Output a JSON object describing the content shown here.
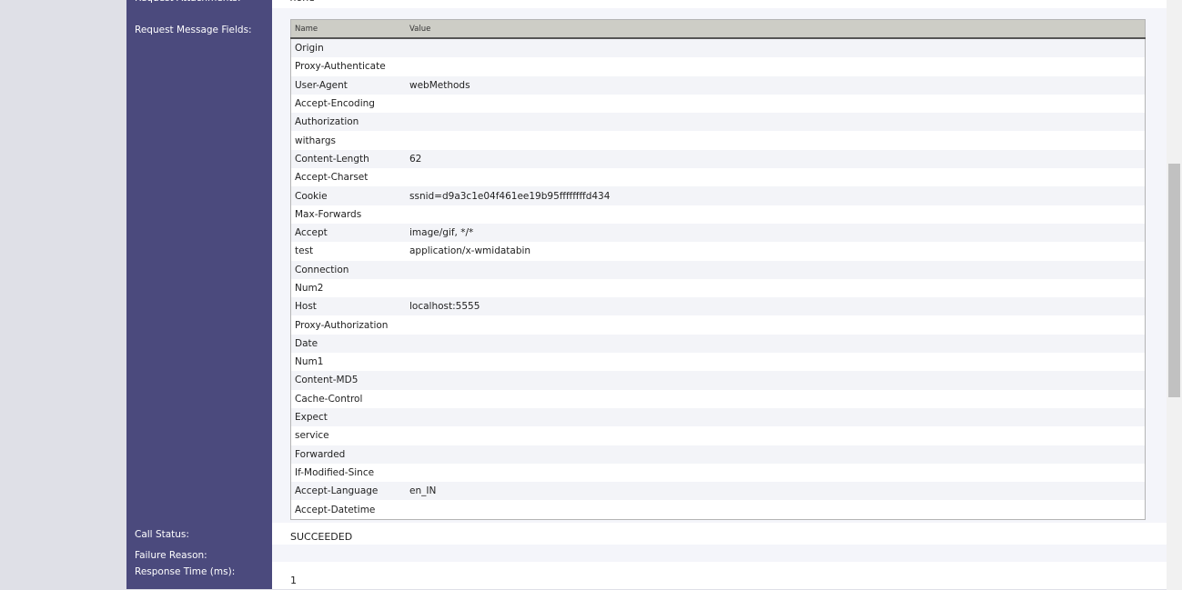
{
  "request_attachments": {
    "label": "Request Attachments:",
    "value": "none"
  },
  "request_message_fields": {
    "label": "Request Message Fields:",
    "columns": [
      "Name",
      "Value"
    ],
    "rows": [
      {
        "name": "Origin",
        "value": ""
      },
      {
        "name": "Proxy-Authenticate",
        "value": ""
      },
      {
        "name": "User-Agent",
        "value": "webMethods"
      },
      {
        "name": "Accept-Encoding",
        "value": ""
      },
      {
        "name": "Authorization",
        "value": ""
      },
      {
        "name": "withargs",
        "value": ""
      },
      {
        "name": "Content-Length",
        "value": "62"
      },
      {
        "name": "Accept-Charset",
        "value": ""
      },
      {
        "name": "Cookie",
        "value": "ssnid=d9a3c1e04f461ee19b95ffffffffd434"
      },
      {
        "name": "Max-Forwards",
        "value": ""
      },
      {
        "name": "Accept",
        "value": "image/gif, */*"
      },
      {
        "name": "test",
        "value": "application/x-wmidatabin"
      },
      {
        "name": "Connection",
        "value": ""
      },
      {
        "name": "Num2",
        "value": ""
      },
      {
        "name": "Host",
        "value": "localhost:5555"
      },
      {
        "name": "Proxy-Authorization",
        "value": ""
      },
      {
        "name": "Date",
        "value": ""
      },
      {
        "name": "Num1",
        "value": ""
      },
      {
        "name": "Content-MD5",
        "value": ""
      },
      {
        "name": "Cache-Control",
        "value": ""
      },
      {
        "name": "Expect",
        "value": ""
      },
      {
        "name": "service",
        "value": ""
      },
      {
        "name": "Forwarded",
        "value": ""
      },
      {
        "name": "If-Modified-Since",
        "value": ""
      },
      {
        "name": "Accept-Language",
        "value": "en_IN"
      },
      {
        "name": "Accept-Datetime",
        "value": ""
      }
    ]
  },
  "call_status": {
    "label": "Call Status:",
    "value": "SUCCEEDED"
  },
  "failure_reason": {
    "label": "Failure Reason:",
    "value": ""
  },
  "response_time": {
    "label": "Response Time (ms):",
    "value": "1"
  }
}
